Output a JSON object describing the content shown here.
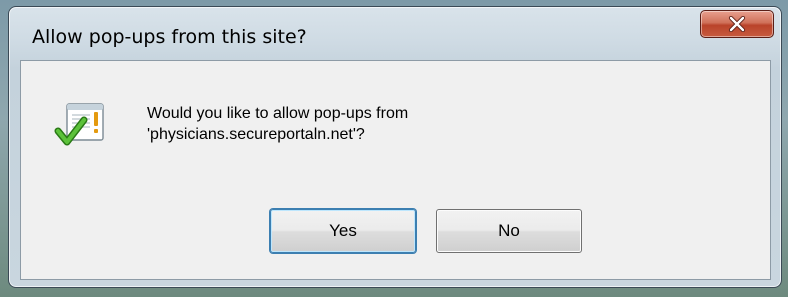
{
  "dialog": {
    "title": "Allow pop-ups from this site?",
    "close_label": "x",
    "message_line1": "Would you like to allow pop-ups from",
    "message_line2": "'physicians.secureportaln.net'?",
    "icon": "popup-permission-warning-icon",
    "buttons": {
      "yes_label": "Yes",
      "no_label": "No"
    }
  },
  "colors": {
    "title_bar": "#c9d6df",
    "close_button": "#c75b3f",
    "client_area": "#f0f0f0",
    "default_button_border": "#3c7fb1"
  }
}
